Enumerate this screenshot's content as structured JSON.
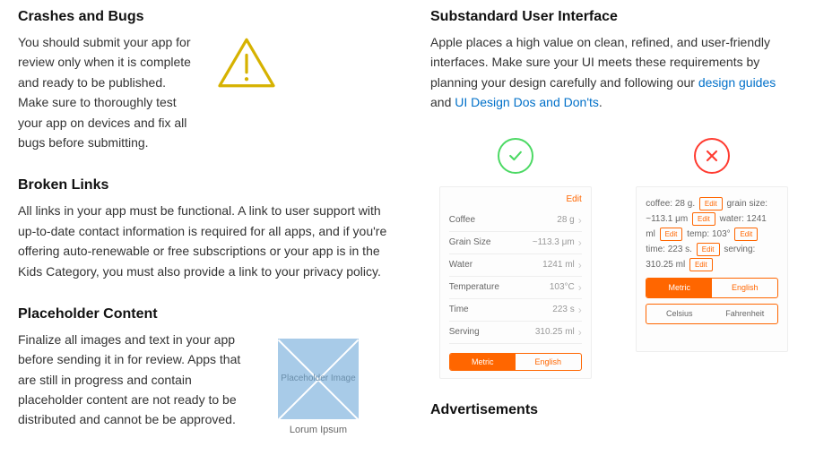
{
  "left": {
    "crashes": {
      "title": "Crashes and Bugs",
      "body": "You should submit your app for review only when it is complete and ready to be published. Make sure to thoroughly test your app on devices and fix all bugs before submitting."
    },
    "broken": {
      "title": "Broken Links",
      "body": "All links in your app must be functional. A link to user support with up-to-date contact information is required for all apps, and if you're offering auto-renewable or free subscriptions or your app is in the Kids Category, you must also provide a link to your privacy policy."
    },
    "placeholder": {
      "title": "Placeholder Content",
      "body": "Finalize all images and text in your app before sending it in for review. Apps that are still in progress and contain placeholder content are not ready to be distributed and cannot be be approved.",
      "img_text": "Placeholder Image",
      "caption": "Lorum Ipsum"
    }
  },
  "right": {
    "ui": {
      "title": "Substandard User Interface",
      "body_pre": "Apple places a high value on clean, refined, and user-friendly interfaces. Make sure your UI meets these requirements by planning your design carefully and following our ",
      "link1": "design guides",
      "mid": " and ",
      "link2": "UI Design Dos and Don'ts",
      "tail": "."
    },
    "good_phone": {
      "edit": "Edit",
      "rows": [
        {
          "label": "Coffee",
          "value": "28 g"
        },
        {
          "label": "Grain Size",
          "value": "~113.3 μm"
        },
        {
          "label": "Water",
          "value": "1241 ml"
        },
        {
          "label": "Temperature",
          "value": "103°C"
        },
        {
          "label": "Time",
          "value": "223 s"
        },
        {
          "label": "Serving",
          "value": "310.25 ml"
        }
      ],
      "seg_on": "Metric",
      "seg_off": "English"
    },
    "bad_phone": {
      "lines": {
        "l1_a": "coffee: 28 g.",
        "l1_edit": "Edit",
        "l1_b": "grain size:",
        "l2_a": "~113.1 μm",
        "l2_edit": "Edit",
        "l2_b": "water: 1241",
        "l3_a": "ml",
        "l3_edit": "Edit",
        "l3_b": "temp: 103°",
        "l3_edit2": "Edit",
        "l4_a": "time: 223 s.",
        "l4_edit": "Edit",
        "l4_b": "serving:",
        "l5": "310.25 ml",
        "l5_edit": "Edit"
      },
      "seg1_on": "Metric",
      "seg1_off": "English",
      "seg2_on": "Celsius",
      "seg2_off": "Fahrenheit"
    },
    "ads": {
      "title": "Advertisements"
    }
  }
}
